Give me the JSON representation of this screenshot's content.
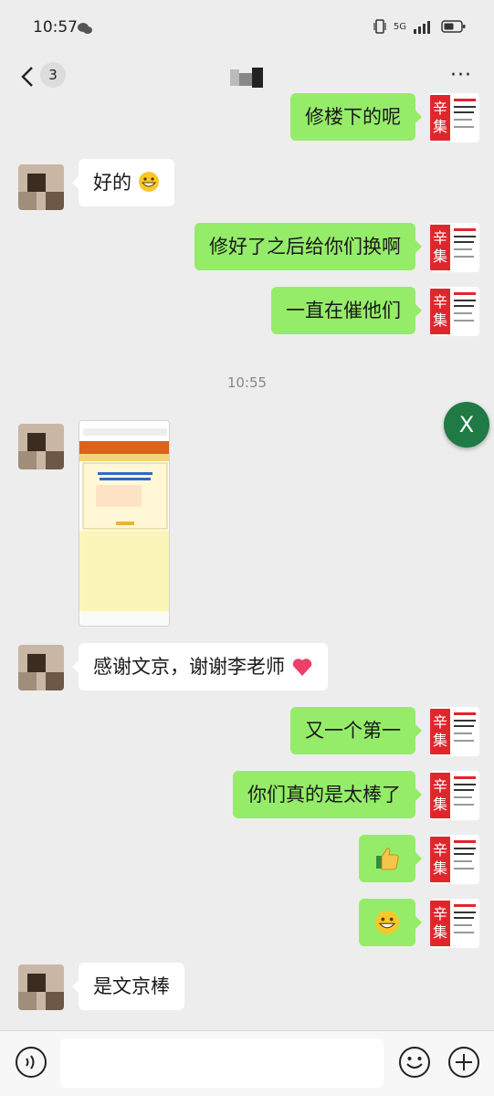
{
  "status_bar": {
    "time": "10:57",
    "network": "5G"
  },
  "nav": {
    "unread_count": "3",
    "more_label": "···"
  },
  "messages": [
    {
      "side": "right",
      "text": "修楼下的呢"
    },
    {
      "side": "left",
      "text": "好的",
      "emoji": "grinning-face"
    },
    {
      "side": "right",
      "text": "修好了之后给你们换啊"
    },
    {
      "side": "right",
      "text": "一直在催他们"
    },
    {
      "side": "left",
      "type": "image",
      "text": "screenshot-thumbnail"
    },
    {
      "side": "left",
      "text": "感谢文京，谢谢李老师",
      "emoji": "heart"
    },
    {
      "side": "right",
      "text": "又一个第一"
    },
    {
      "side": "right",
      "text": "你们真的是太棒了"
    },
    {
      "side": "right",
      "type": "emoji",
      "text": "thumbs-up"
    },
    {
      "side": "right",
      "type": "emoji",
      "text": "grinning-face"
    },
    {
      "side": "left",
      "text": "是文京棒"
    }
  ],
  "time_separator": "10:55",
  "floating_close": "X",
  "avatar_right_badge_char_top": "辛",
  "avatar_right_badge_char_bottom": "集",
  "colors": {
    "bubble_right": "#95ec69",
    "bubble_left": "#ffffff",
    "background": "#ededed",
    "fab": "#1f7a45"
  }
}
